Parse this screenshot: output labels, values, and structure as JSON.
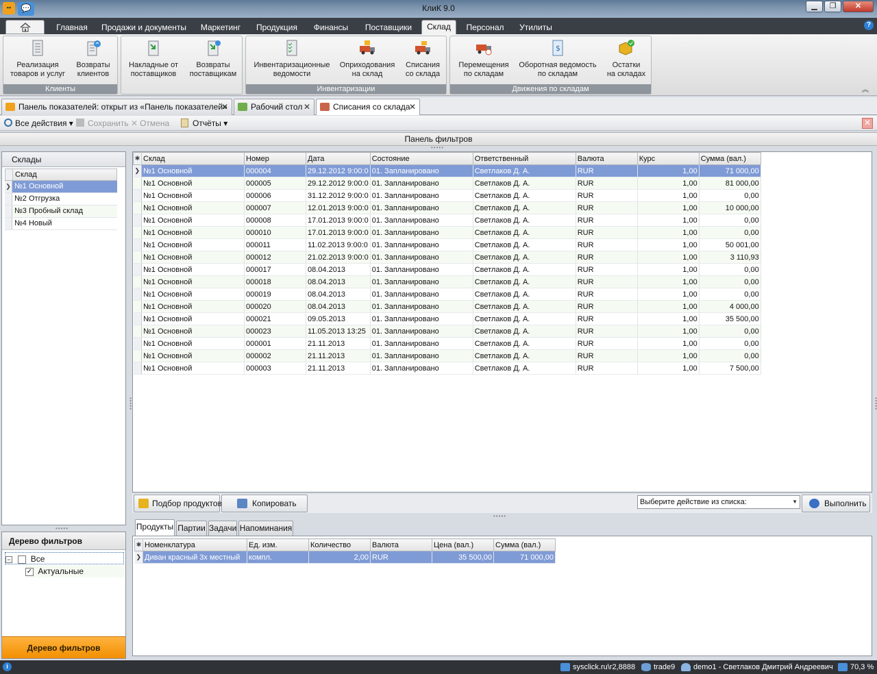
{
  "window": {
    "title": "КлиК 9.0",
    "min_label": "▁",
    "max_label": "❐",
    "close_label": "✕"
  },
  "ribbon_tabs": [
    "Главная",
    "Продажи и документы",
    "Маркетинг",
    "Продукция",
    "Финансы",
    "Поставщики",
    "Склад",
    "Персонал",
    "Утилиты"
  ],
  "ribbon_active_tab": "Склад",
  "ribbon_groups": {
    "clients": {
      "label": "Клиенты",
      "buttons": [
        {
          "label": "Реализация\nтоваров и услуг",
          "icon": "document-list-icon"
        },
        {
          "label": "Возвраты\nклиентов",
          "icon": "document-return-icon"
        }
      ]
    },
    "suppliers": {
      "buttons": [
        {
          "label": "Накладные от\nпоставщиков",
          "icon": "document-in-icon"
        },
        {
          "label": "Возвраты\nпоставщикам",
          "icon": "document-out-icon"
        }
      ]
    },
    "inventory": {
      "label": "Инвентаризации",
      "buttons": [
        {
          "label": "Инвентаризационные\nведомости",
          "icon": "checklist-icon"
        },
        {
          "label": "Оприходования\nна склад",
          "icon": "truck-in-icon"
        },
        {
          "label": "Списания\nсо склада",
          "icon": "truck-out-icon"
        }
      ]
    },
    "movements": {
      "label": "Движения по складам",
      "buttons": [
        {
          "label": "Перемещения\nпо складам",
          "icon": "truck-move-icon"
        },
        {
          "label": "Оборотная ведомость\nпо складам",
          "icon": "money-sheet-icon"
        },
        {
          "label": "Остатки\nна складах",
          "icon": "box-check-icon"
        }
      ]
    }
  },
  "doc_tabs": [
    {
      "label": "Панель показателей: открыт из «Панель показателей»"
    },
    {
      "label": "Рабочий стол"
    },
    {
      "label": "Списания со склада"
    }
  ],
  "toolbar": {
    "all_actions": "Все действия",
    "save": "Сохранить",
    "cancel": "Отмена",
    "reports": "Отчёты"
  },
  "filter_panel_title": "Панель фильтров",
  "warehouses": {
    "title": "Склады",
    "column": "Склад",
    "items": [
      "№1 Основной",
      "№2 Отгрузка",
      "№3 Пробный склад",
      "№4 Новый"
    ]
  },
  "filter_tree": {
    "title": "Дерево фильтров",
    "root": "Все",
    "child": "Актуальные",
    "footer": "Дерево фильтров"
  },
  "main_grid": {
    "columns": [
      "Склад",
      "Номер",
      "Дата",
      "Состояние",
      "Ответственный",
      "Валюта",
      "Курс",
      "Сумма (вал.)"
    ],
    "rows": [
      [
        "№1 Основной",
        "000004",
        "29.12.2012 9:00:0",
        "01. Запланировано",
        "Светлаков Д. А.",
        "RUR",
        "1,00",
        "71 000,00"
      ],
      [
        "№1 Основной",
        "000005",
        "29.12.2012 9:00:0",
        "01. Запланировано",
        "Светлаков Д. А.",
        "RUR",
        "1,00",
        "81 000,00"
      ],
      [
        "№1 Основной",
        "000006",
        "31.12.2012 9:00:0",
        "01. Запланировано",
        "Светлаков Д. А.",
        "RUR",
        "1,00",
        "0,00"
      ],
      [
        "№1 Основной",
        "000007",
        "12.01.2013 9:00:0",
        "01. Запланировано",
        "Светлаков Д. А.",
        "RUR",
        "1,00",
        "10 000,00"
      ],
      [
        "№1 Основной",
        "000008",
        "17.01.2013 9:00:0",
        "01. Запланировано",
        "Светлаков Д. А.",
        "RUR",
        "1,00",
        "0,00"
      ],
      [
        "№1 Основной",
        "000010",
        "17.01.2013 9:00:0",
        "01. Запланировано",
        "Светлаков Д. А.",
        "RUR",
        "1,00",
        "0,00"
      ],
      [
        "№1 Основной",
        "000011",
        "11.02.2013 9:00:0",
        "01. Запланировано",
        "Светлаков Д. А.",
        "RUR",
        "1,00",
        "50 001,00"
      ],
      [
        "№1 Основной",
        "000012",
        "21.02.2013 9:00:0",
        "01. Запланировано",
        "Светлаков Д. А.",
        "RUR",
        "1,00",
        "3 110,93"
      ],
      [
        "№1 Основной",
        "000017",
        "08.04.2013",
        "01. Запланировано",
        "Светлаков Д. А.",
        "RUR",
        "1,00",
        "0,00"
      ],
      [
        "№1 Основной",
        "000018",
        "08.04.2013",
        "01. Запланировано",
        "Светлаков Д. А.",
        "RUR",
        "1,00",
        "0,00"
      ],
      [
        "№1 Основной",
        "000019",
        "08.04.2013",
        "01. Запланировано",
        "Светлаков Д. А.",
        "RUR",
        "1,00",
        "0,00"
      ],
      [
        "№1 Основной",
        "000020",
        "08.04.2013",
        "01. Запланировано",
        "Светлаков Д. А.",
        "RUR",
        "1,00",
        "4 000,00"
      ],
      [
        "№1 Основной",
        "000021",
        "09.05.2013",
        "01. Запланировано",
        "Светлаков Д. А.",
        "RUR",
        "1,00",
        "35 500,00"
      ],
      [
        "№1 Основной",
        "000023",
        "11.05.2013 13:25",
        "01. Запланировано",
        "Светлаков Д. А.",
        "RUR",
        "1,00",
        "0,00"
      ],
      [
        "№1 Основной",
        "000001",
        "21.11.2013",
        "01. Запланировано",
        "Светлаков Д. А.",
        "RUR",
        "1,00",
        "0,00"
      ],
      [
        "№1 Основной",
        "000002",
        "21.11.2013",
        "01. Запланировано",
        "Светлаков Д. А.",
        "RUR",
        "1,00",
        "0,00"
      ],
      [
        "№1 Основной",
        "000003",
        "21.11.2013",
        "01. Запланировано",
        "Светлаков Д. А.",
        "RUR",
        "1,00",
        "7 500,00"
      ]
    ]
  },
  "actions": {
    "pick_products": "Подбор продуктов",
    "copy": "Копировать",
    "action_select_placeholder": "Выберите действие из списка:",
    "execute": "Выполнить"
  },
  "sub_tabs": [
    "Продукты",
    "Партии",
    "Задачи",
    "Напоминания"
  ],
  "detail_grid": {
    "columns": [
      "Номенклатура",
      "Ед. изм.",
      "Количество",
      "Валюта",
      "Цена (вал.)",
      "Сумма (вал.)"
    ],
    "rows": [
      [
        "Диван красный 3х местный",
        "компл.",
        "2,00",
        "RUR",
        "35 500,00",
        "71 000,00"
      ]
    ]
  },
  "statusbar": {
    "server": "sysclick.ru\\r2,8888",
    "database": "trade9",
    "user": "demo1 - Светлаков Дмитрий Андреевич",
    "zoom": "70,3 %"
  },
  "colors": {
    "selection": "#7f9bd6",
    "alt_row": "#f5fbf3",
    "accent_orange": "#f28f00"
  }
}
